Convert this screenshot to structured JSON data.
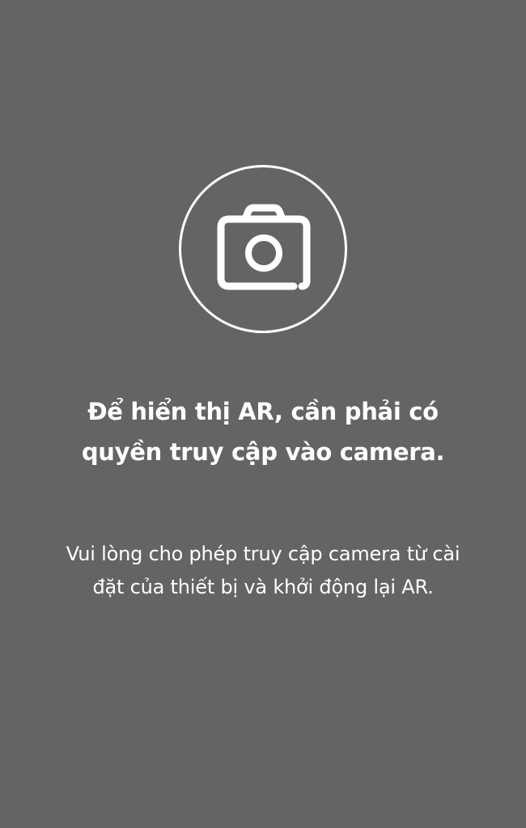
{
  "permission_screen": {
    "icon": "camera-icon",
    "title": "Để hiển thị AR, cần phải có quyền truy cập vào camera.",
    "message": "Vui lòng cho phép truy cập camera từ cài đặt của thiết bị và khởi động lại AR."
  },
  "colors": {
    "background": "#646464",
    "foreground": "#ffffff"
  }
}
